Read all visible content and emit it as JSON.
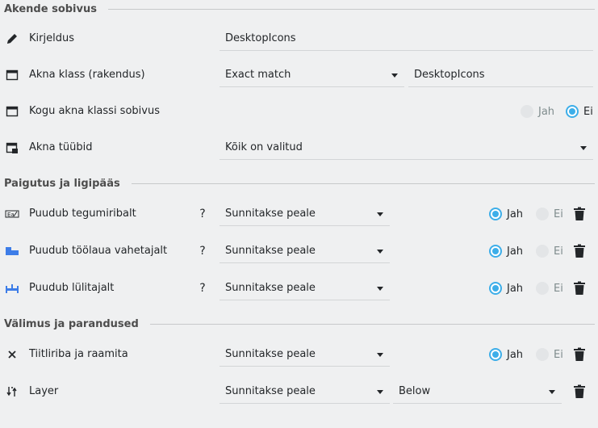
{
  "sections": {
    "window_match": "Akende sobivus",
    "placement": "Paigutus ja ligipääs",
    "appearance": "Välimus ja parandused"
  },
  "window_match": {
    "description": {
      "label": "Kirjeldus",
      "value": "DesktopIcons",
      "icon": "pencil-icon"
    },
    "window_class": {
      "label": "Akna klass (rakendus)",
      "match": "Exact match",
      "value": "DesktopIcons",
      "icon": "window-icon"
    },
    "whole_class": {
      "label": "Kogu akna klassi sobivus",
      "yes": "Jah",
      "no": "Ei",
      "selected": "no",
      "icon": "window-icon"
    },
    "window_types": {
      "label": "Akna tüübid",
      "value": "Kõik on valitud",
      "icon": "window-types-icon"
    }
  },
  "placement": [
    {
      "label": "Puudub tegumiribalt",
      "help": "?",
      "policy": "Sunnitakse peale",
      "yes": "Jah",
      "no": "Ei",
      "selected": "yes",
      "icon": "taskbar-icon"
    },
    {
      "label": "Puudub töölaua vahetajalt",
      "help": "?",
      "policy": "Sunnitakse peale",
      "yes": "Jah",
      "no": "Ei",
      "selected": "yes",
      "icon": "pager-icon"
    },
    {
      "label": "Puudub lülitajalt",
      "help": "?",
      "policy": "Sunnitakse peale",
      "yes": "Jah",
      "no": "Ei",
      "selected": "yes",
      "icon": "switcher-icon"
    }
  ],
  "appearance": {
    "titlebar": {
      "label": "Tiitliriba ja raamita",
      "policy": "Sunnitakse peale",
      "yes": "Jah",
      "no": "Ei",
      "selected": "yes",
      "icon": "close-x-icon"
    },
    "layer": {
      "label": "Layer",
      "policy": "Sunnitakse peale",
      "value": "Below",
      "icon": "layer-icon"
    }
  },
  "colors": {
    "accent": "#3daee9",
    "background": "#eff0f1",
    "text": "#232629"
  }
}
